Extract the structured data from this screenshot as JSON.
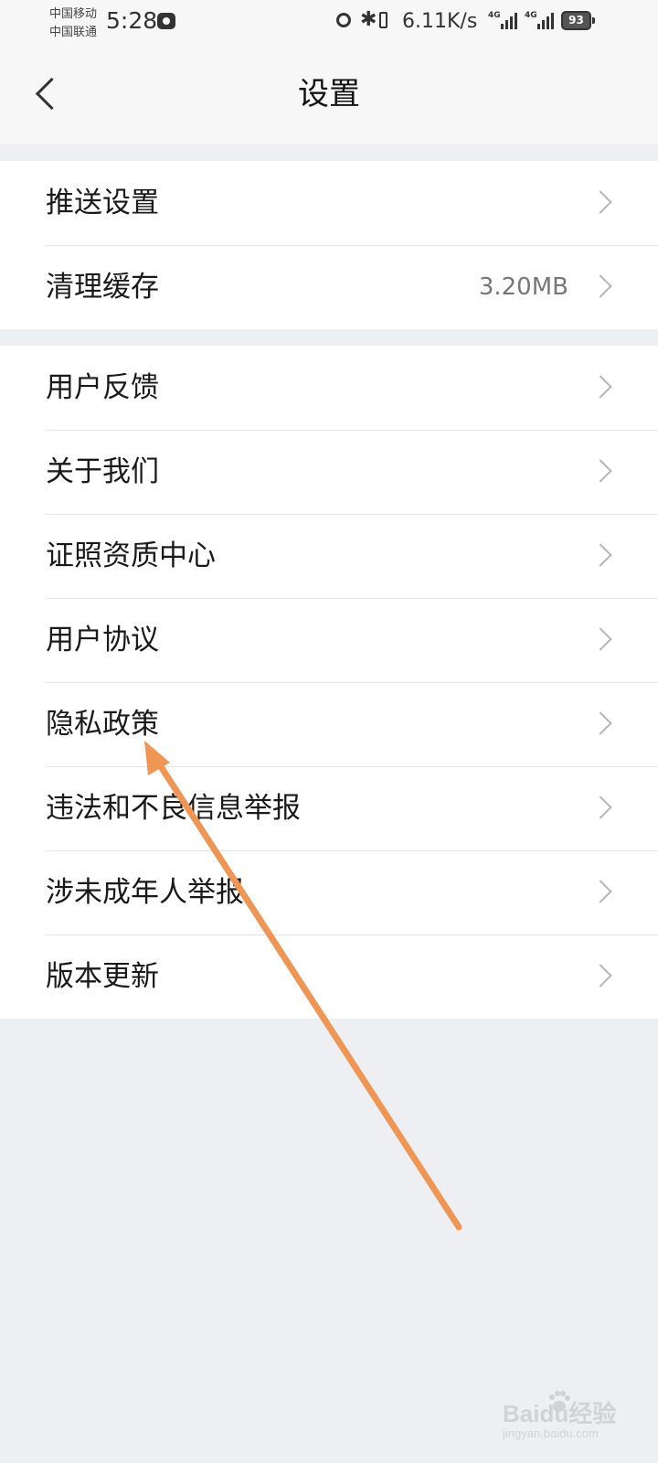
{
  "status_bar": {
    "carrier_1": "中国移动",
    "carrier_2": "中国联通",
    "time": "5:28",
    "network_speed": "6.11K/s",
    "signal_1_type": "4G",
    "signal_2_type": "4G",
    "battery": "93",
    "bluetooth_symbol": "✱"
  },
  "header": {
    "title": "设置"
  },
  "groups": [
    {
      "items": [
        {
          "label": "推送设置",
          "value": ""
        },
        {
          "label": "清理缓存",
          "value": "3.20MB"
        }
      ]
    },
    {
      "items": [
        {
          "label": "用户反馈",
          "value": ""
        },
        {
          "label": "关于我们",
          "value": ""
        },
        {
          "label": "证照资质中心",
          "value": ""
        },
        {
          "label": "用户协议",
          "value": ""
        },
        {
          "label": "隐私政策",
          "value": ""
        },
        {
          "label": "违法和不良信息举报",
          "value": ""
        },
        {
          "label": "涉未成年人举报",
          "value": ""
        },
        {
          "label": "版本更新",
          "value": ""
        }
      ]
    }
  ],
  "watermark": {
    "brand": "Baidu经验",
    "sub": "jingyan.baidu.com"
  },
  "colors": {
    "background": "#eeeff3",
    "card": "#ffffff",
    "annotation_arrow": "#ef9654"
  }
}
